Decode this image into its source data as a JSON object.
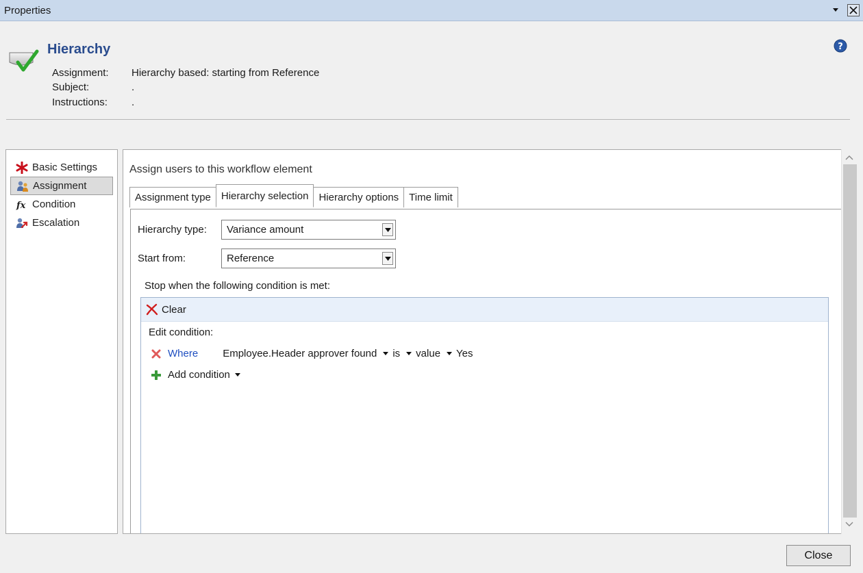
{
  "window": {
    "title": "Properties"
  },
  "header": {
    "title": "Hierarchy",
    "rows": [
      {
        "label": "Assignment:",
        "value": "Hierarchy based: starting from Reference"
      },
      {
        "label": "Subject:",
        "value": "."
      },
      {
        "label": "Instructions:",
        "value": "."
      }
    ]
  },
  "sidebar": {
    "items": [
      {
        "label": "Basic Settings",
        "icon": "asterisk-icon"
      },
      {
        "label": "Assignment",
        "icon": "users-icon"
      },
      {
        "label": "Condition",
        "icon": "function-icon"
      },
      {
        "label": "Escalation",
        "icon": "escalation-icon"
      }
    ]
  },
  "main": {
    "title": "Assign users to this workflow element",
    "tabs": [
      {
        "label": "Assignment type"
      },
      {
        "label": "Hierarchy selection",
        "active": true
      },
      {
        "label": "Hierarchy options"
      },
      {
        "label": "Time limit"
      }
    ],
    "hierarchy_type": {
      "label": "Hierarchy type:",
      "value": "Variance amount"
    },
    "start_from": {
      "label": "Start from:",
      "value": "Reference"
    },
    "stop_label": "Stop when the following condition is met:",
    "condition": {
      "clear_label": "Clear",
      "edit_label": "Edit condition:",
      "where_label": "Where",
      "field": "Employee.Header approver found",
      "operator": "is",
      "value_type": "value",
      "value": "Yes",
      "add_label": "Add condition"
    }
  },
  "footer": {
    "close_label": "Close"
  },
  "colors": {
    "accent": "#2a4c8e",
    "link": "#1f4fc0",
    "titlebar": "#c9d9ec"
  }
}
